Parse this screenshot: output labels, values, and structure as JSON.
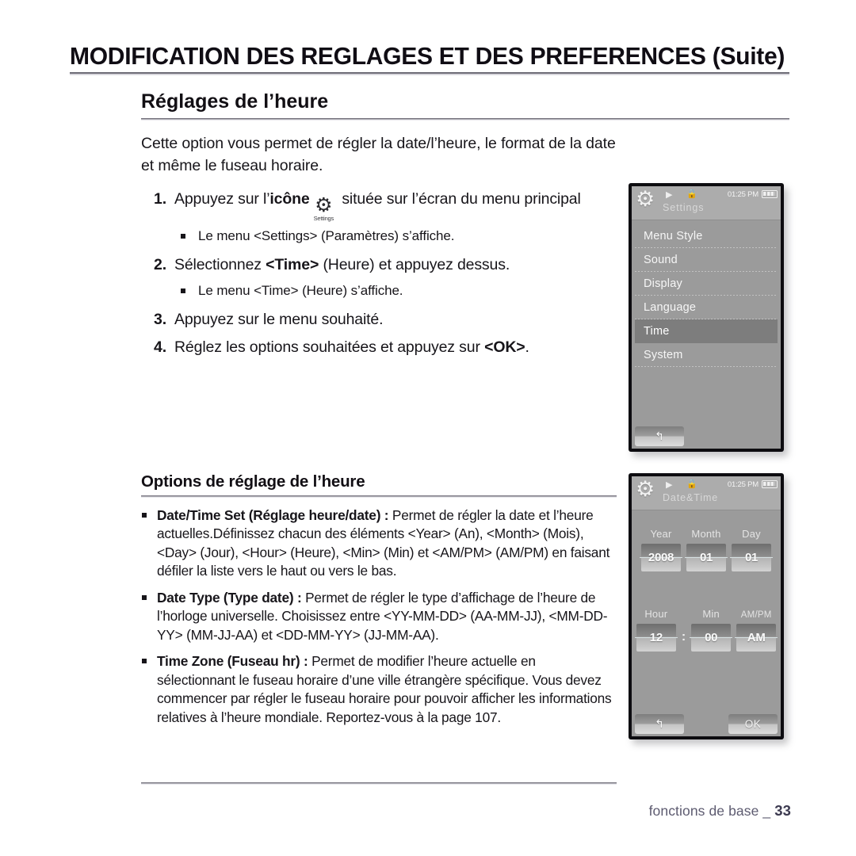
{
  "header": {
    "title": "MODIFICATION DES REGLAGES ET DES PREFERENCES (Suite)"
  },
  "section": {
    "title": "Réglages de l’heure",
    "intro": "Cette option vous permet de régler la date/l’heure, le format de la date et même le fuseau horaire."
  },
  "steps": [
    {
      "num": "1.",
      "text_before": "Appuyez sur l’",
      "bold": "icône",
      "icon_name": "settings-gear-icon",
      "icon_caption": "Settings",
      "text_after": " située sur l’écran du menu principal",
      "sub": "Le menu <Settings> (Paramètres) s’affiche."
    },
    {
      "num": "2.",
      "text_before": "Sélectionnez ",
      "bold": "<Time>",
      "text_after": " (Heure) et appuyez dessus.",
      "sub": "Le menu <Time> (Heure) s’affiche."
    },
    {
      "num": "3.",
      "text_before": "Appuyez sur le menu souhaité.",
      "bold": "",
      "text_after": "",
      "sub": ""
    },
    {
      "num": "4.",
      "text_before": "Réglez les options souhaitées et appuyez sur ",
      "bold": "<OK>",
      "text_after": ".",
      "sub": ""
    }
  ],
  "options": {
    "heading": "Options de réglage de l’heure",
    "items": [
      {
        "bold": "Date/Time Set (Réglage heure/date) :",
        "text": " Permet de régler la date et l’heure actuelles.Définissez chacun des éléments <Year> (An), <Month> (Mois), <Day> (Jour), <Hour> (Heure), <Min> (Min) et <AM/PM> (AM/PM) en faisant défiler la liste vers le haut ou vers le bas."
      },
      {
        "bold": "Date Type (Type date) :",
        "text": " Permet de régler le type d’affichage de l’heure de l’horloge universelle. Choisissez entre <YY-MM-DD> (AA-MM-JJ), <MM-DD-YY> (MM-JJ-AA) et <DD-MM-YY> (JJ-MM-AA)."
      },
      {
        "bold": "Time Zone (Fuseau hr) :",
        "text": " Permet de modifier l’heure actuelle en sélectionnant le fuseau horaire d’une ville étrangère spécifique. Vous devez commencer par régler le fuseau horaire pour pouvoir afficher les informations relatives à l’heure mondiale. Reportez-vous à la page 107."
      }
    ]
  },
  "footer": {
    "label": "fonctions de base _",
    "page": "33"
  },
  "device_settings": {
    "statusbar": {
      "time": "01:25 PM",
      "play_icon": "play-icon",
      "lock_icon": "lock-icon",
      "battery_icon": "battery-icon",
      "gear_icon": "gear-icon"
    },
    "title": "Settings",
    "menu_items": [
      {
        "label": "Menu Style",
        "selected": false
      },
      {
        "label": "Sound",
        "selected": false
      },
      {
        "label": "Display",
        "selected": false
      },
      {
        "label": "Language",
        "selected": false
      },
      {
        "label": "Time",
        "selected": true
      },
      {
        "label": "System",
        "selected": false
      }
    ],
    "softkey_back": "↰"
  },
  "device_datetime": {
    "statusbar": {
      "time": "01:25 PM",
      "play_icon": "play-icon",
      "lock_icon": "lock-icon",
      "battery_icon": "battery-icon",
      "gear_icon": "gear-icon"
    },
    "title": "Date&Time",
    "row1": [
      {
        "label": "Year",
        "value": "2008"
      },
      {
        "label": "Month",
        "value": "01"
      },
      {
        "label": "Day",
        "value": "01"
      }
    ],
    "row2": [
      {
        "label": "Hour",
        "value": "12"
      },
      {
        "label": "Min",
        "value": "00"
      },
      {
        "label": "AM/PM",
        "value": "AM"
      }
    ],
    "colon": ":",
    "softkey_back": "↰",
    "softkey_ok": "OK"
  },
  "colors": {
    "screen_bg": "#9b9b9b",
    "statusbar_bg": "#acacac",
    "selected_row": "#7d7d7d",
    "frame": "#0d0c10",
    "footer_text": "#5d5b70"
  }
}
